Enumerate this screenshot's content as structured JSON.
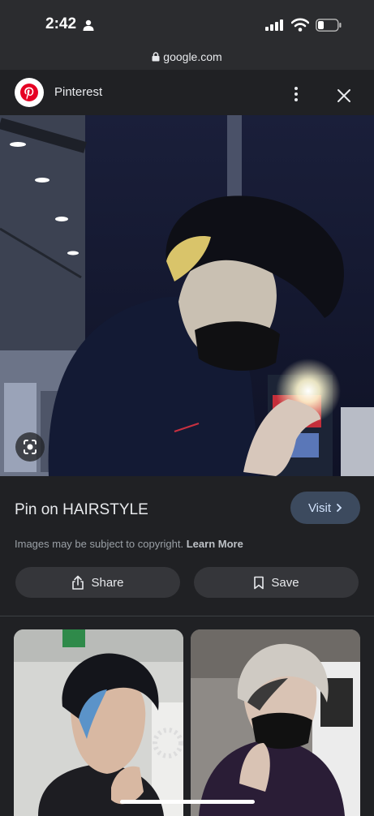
{
  "status": {
    "time": "2:42"
  },
  "browser": {
    "url": "google.com"
  },
  "source": {
    "name": "Pinterest"
  },
  "pin": {
    "title": "Pin on HAIRSTYLE",
    "visit_label": "Visit",
    "copyright_text": "Images may be subject to copyright.",
    "learn_more": "Learn More",
    "share_label": "Share",
    "save_label": "Save"
  },
  "colors": {
    "accent": "#3c4a5e",
    "background": "#202124",
    "pinterest": "#e60023"
  }
}
